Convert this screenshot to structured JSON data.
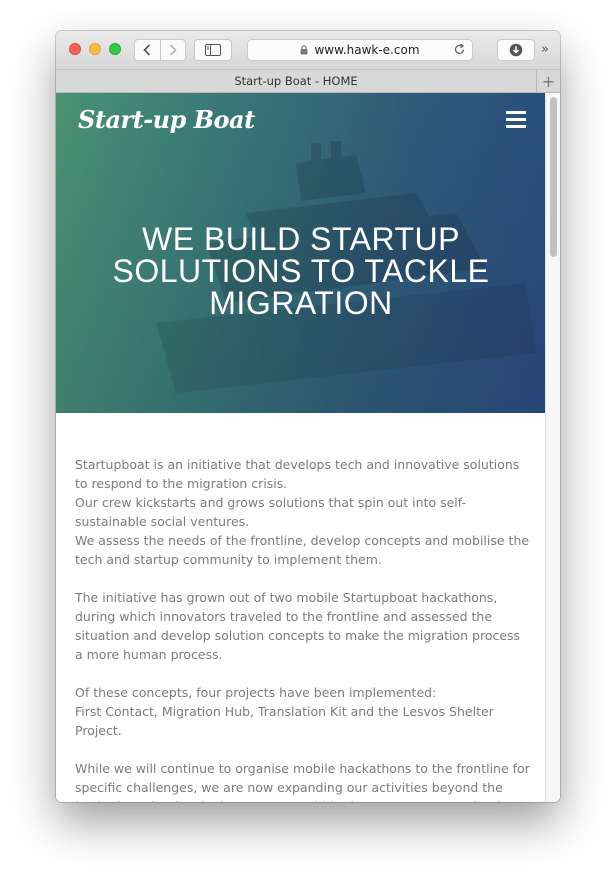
{
  "browser": {
    "url": "www.hawk-e.com",
    "tab_title": "Start-up Boat - HOME"
  },
  "site": {
    "logo_text": "Start-up Boat",
    "hero_title": "We build startup solutions to tackle migration"
  },
  "content": {
    "paragraphs": [
      [
        "Startupboat is an initiative that develops tech and innovative solutions to respond to the migration crisis.",
        "Our crew kickstarts and grows solutions that spin out into self-sustainable social ventures.",
        "We assess the needs of the frontline, develop concepts and mobilise the tech and startup community to implement them."
      ],
      [
        "The initiative has grown out of two mobile Startupboat hackathons, during which innovators traveled to the frontline and assessed the situation and develop solution concepts to make the migration process a more human process."
      ],
      [
        "Of these concepts, four  projects have been implemented:",
        "First Contact, Migration Hub, Translation Kit and the Lesvos Shelter Project."
      ],
      [
        "While we will continue to organise mobile hackathons to the frontline for specific challenges, we are now expanding our activities beyond the hackathons by developing concepts within the core team, creating lean prototypes and supporting implementation. Startupboat is growing into"
      ]
    ]
  },
  "colors": {
    "hero_start": "#4e9a7a",
    "hero_end": "#2b4e85",
    "body_text": "#7b7b7b"
  }
}
